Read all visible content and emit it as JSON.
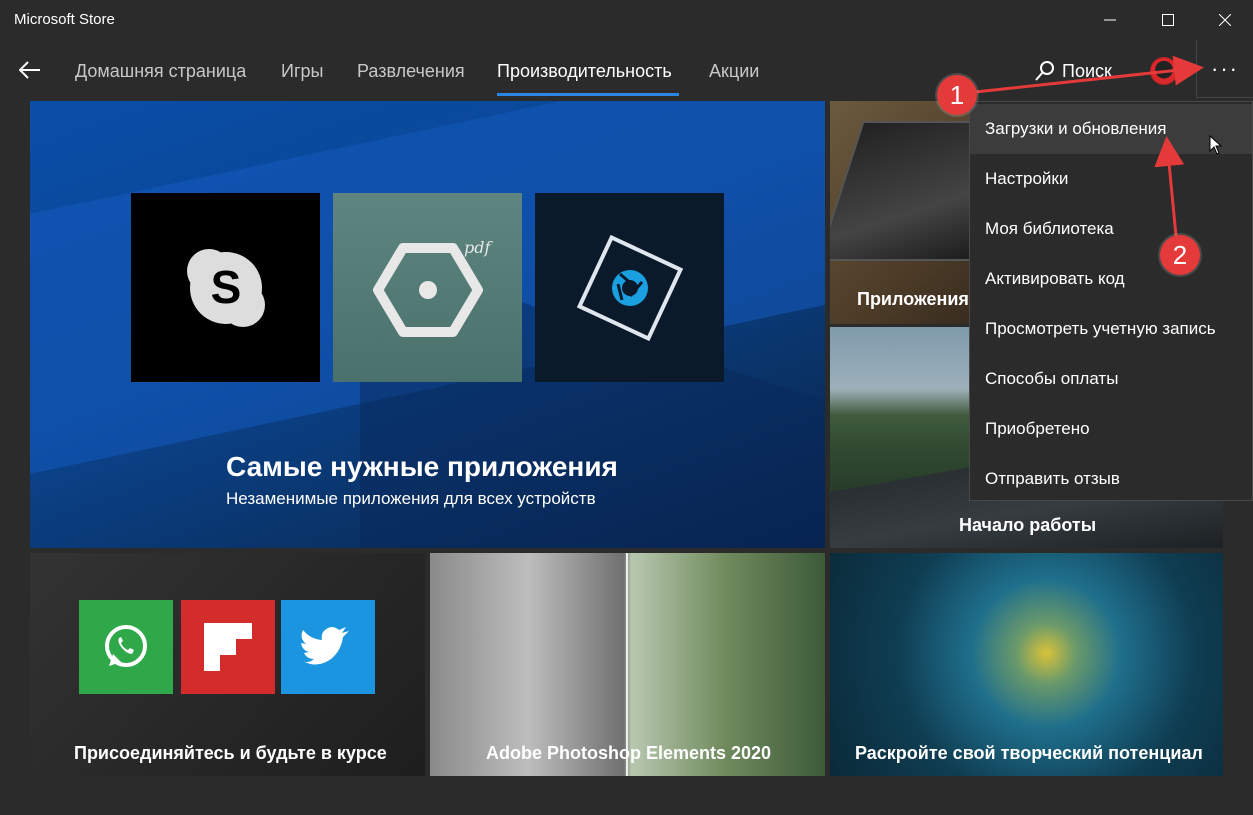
{
  "window": {
    "title": "Microsoft Store"
  },
  "nav": {
    "tabs": [
      {
        "label": "Домашняя страница",
        "active": false
      },
      {
        "label": "Игры",
        "active": false
      },
      {
        "label": "Развлечения",
        "active": false
      },
      {
        "label": "Производительность",
        "active": true
      },
      {
        "label": "Акции",
        "active": false
      }
    ],
    "search_label": "Поиск",
    "more_label": "···",
    "accent": "#2c86e6"
  },
  "hero": {
    "title": "Самые нужные приложения",
    "subtitle": "Незаменимые приложения для всех устройств",
    "pdf_label": "pdf"
  },
  "tiles": {
    "laptop_label": "Приложения",
    "road_label": "Начало работы",
    "social_label": "Присоединяйтесь и будьте в курсе",
    "photo_label": "Adobe Photoshop Elements 2020",
    "paint_label": "Раскройте свой творческий потенциал"
  },
  "menu": {
    "items": [
      "Загрузки и обновления",
      "Настройки",
      "Моя библиотека",
      "Активировать код",
      "Просмотреть учетную запись",
      "Способы оплаты",
      "Приобретено",
      "Отправить отзыв"
    ]
  },
  "annotations": {
    "badge1": "1",
    "badge2": "2",
    "color": "#e43a3a"
  }
}
